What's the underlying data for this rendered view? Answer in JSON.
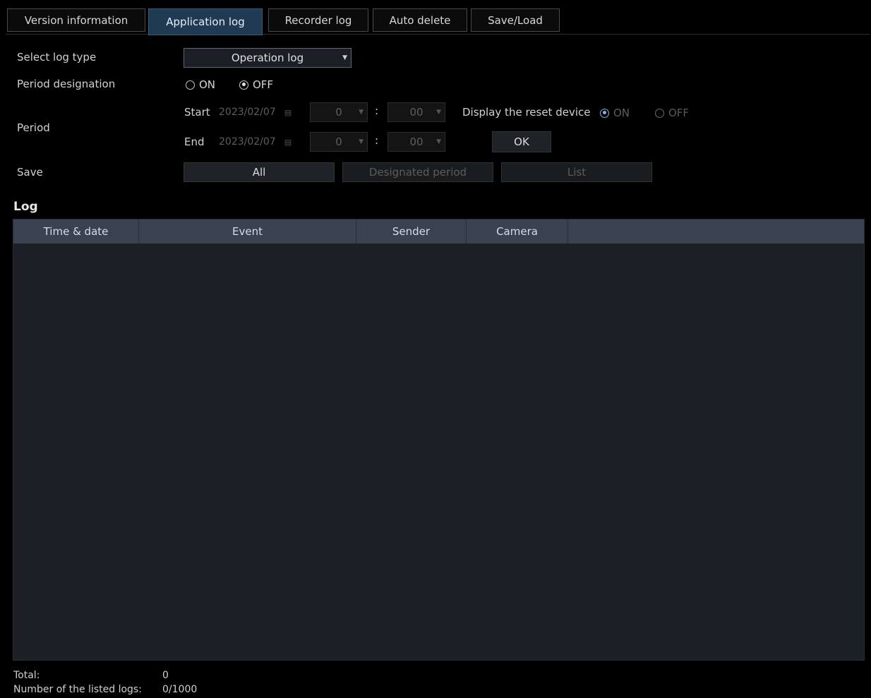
{
  "tabs": [
    {
      "label": "Version information",
      "active": false
    },
    {
      "label": "Application log",
      "active": true
    },
    {
      "label": "Recorder log",
      "active": false
    },
    {
      "label": "Auto delete",
      "active": false
    },
    {
      "label": "Save/Load",
      "active": false
    }
  ],
  "form": {
    "log_type_label": "Select log type",
    "log_type_value": "Operation log",
    "period_designation_label": "Period designation",
    "period_designation_on": "ON",
    "period_designation_off": "OFF",
    "period_designation_selected": "OFF",
    "period_label": "Period",
    "start_label": "Start",
    "start_date": "2023/02/07",
    "start_hour": "0",
    "start_minute": "00",
    "end_label": "End",
    "end_date": "2023/02/07",
    "end_hour": "0",
    "end_minute": "00",
    "colon": ":",
    "reset_device_label": "Display the reset device",
    "reset_on": "ON",
    "reset_off": "OFF",
    "reset_selected": "ON",
    "ok_label": "OK",
    "save_label": "Save",
    "save_all": "All",
    "save_designated": "Designated period",
    "save_list": "List"
  },
  "log": {
    "title": "Log",
    "columns": [
      "Time & date",
      "Event",
      "Sender",
      "Camera"
    ],
    "rows": []
  },
  "footer": {
    "total_label": "Total:",
    "total_value": "0",
    "listed_label": "Number of the listed logs:",
    "listed_value": "0/1000"
  },
  "colors": {
    "background": "#000000",
    "active_tab": "#1f3a52",
    "table_header": "#3a4150",
    "table_body": "#1c2026",
    "radio_accent": "#7fb4e8"
  }
}
